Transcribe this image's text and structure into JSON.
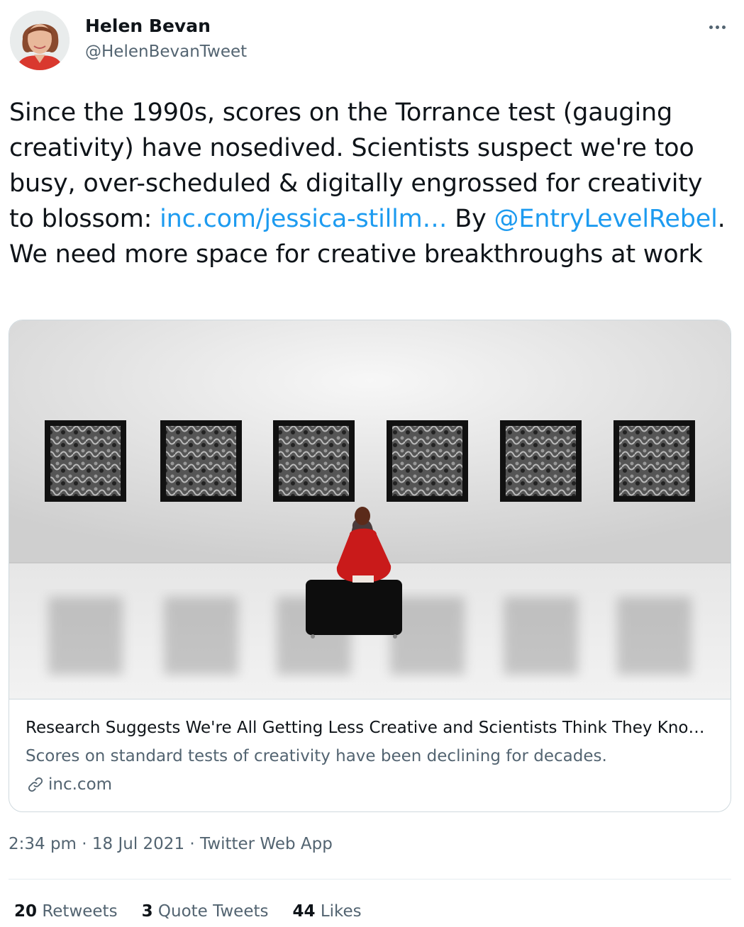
{
  "author": {
    "display_name": "Helen Bevan",
    "handle": "@HelenBevanTweet",
    "avatar_icon": "user-avatar-photo"
  },
  "tweet": {
    "text_part1": "Since the 1990s, scores on the Torrance test (gauging creativity) have nosedived. Scientists suspect we're too busy, over-scheduled & digitally engrossed for creativity to blossom: ",
    "link_text": "inc.com/jessica-stillm…",
    "text_part2": " By ",
    "mention": "@EntryLevelRebel",
    "text_part3": ". We need more space for creative breakthroughs at work",
    "link_color": "#1d9bf0"
  },
  "card": {
    "title": "Research Suggests We're All Getting Less Creative and Scientists Think They Kno…",
    "description": "Scores on standard tests of creativity have been declining for decades.",
    "domain": "inc.com",
    "domain_icon": "link-icon",
    "image_subject": "gallery-photo"
  },
  "meta": {
    "time": "2:34 pm",
    "separator1": " · ",
    "date": "18 Jul 2021",
    "separator2": " · ",
    "source": "Twitter Web App"
  },
  "stats": {
    "retweets_count": "20",
    "retweets_label": "Retweets",
    "quotes_count": "3",
    "quotes_label": "Quote Tweets",
    "likes_count": "44",
    "likes_label": "Likes"
  }
}
